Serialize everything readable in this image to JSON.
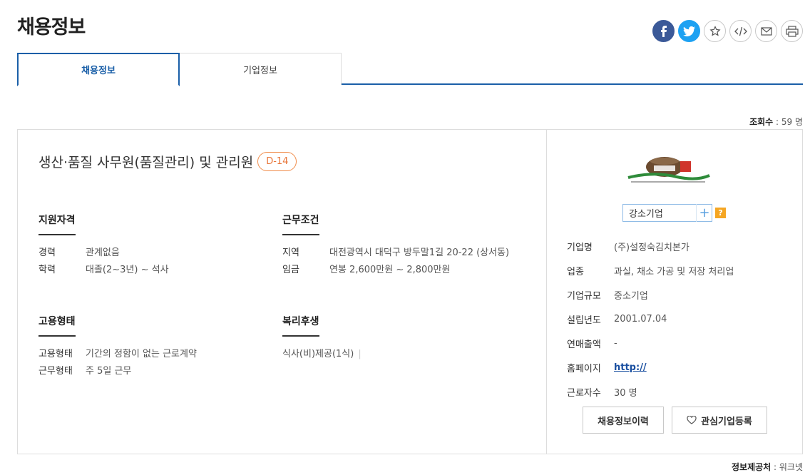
{
  "page": {
    "title": "채용정보"
  },
  "share": {
    "icons": [
      "facebook-icon",
      "twitter-icon",
      "star-icon",
      "embed-icon",
      "mail-icon",
      "print-icon"
    ]
  },
  "tabs": [
    {
      "label": "채용정보",
      "active": true
    },
    {
      "label": "기업정보",
      "active": false
    }
  ],
  "views": {
    "label": "조회수",
    "value": " : 59 명"
  },
  "job": {
    "title": "생산·품질 사무원(품질관리) 및 관리원",
    "dday": "D-14"
  },
  "sections": {
    "qualification": {
      "heading": "지원자격",
      "rows": [
        {
          "key": "경력",
          "value": "관계없음"
        },
        {
          "key": "학력",
          "value": "대졸(2~3년) ~ 석사"
        }
      ]
    },
    "conditions": {
      "heading": "근무조건",
      "rows": [
        {
          "key": "지역",
          "value": "대전광역시 대덕구 방두말1길 20-22 (상서동)"
        },
        {
          "key": "임금",
          "value": "연봉 2,600만원 ~ 2,800만원"
        }
      ]
    },
    "employment": {
      "heading": "고용형태",
      "rows": [
        {
          "key": "고용형태",
          "value": "기간의 정함이 없는 근로계약"
        },
        {
          "key": "근무형태",
          "value": "주 5일 근무"
        }
      ]
    },
    "welfare": {
      "heading": "복리후생",
      "items": "식사(비)제공(1식)"
    }
  },
  "company": {
    "size_badge": "강소기업",
    "size_plus": "+",
    "help": "?",
    "info": [
      {
        "key": "기업명",
        "value": "(주)설정숙김치본가"
      },
      {
        "key": "업종",
        "value": "과실, 채소 가공 및 저장 처리업"
      },
      {
        "key": "기업규모",
        "value": "중소기업"
      },
      {
        "key": "설립년도",
        "value": "2001.07.04"
      },
      {
        "key": "연매출액",
        "value": "-"
      },
      {
        "key": "홈페이지",
        "value": "http://"
      },
      {
        "key": "근로자수",
        "value": "30 명"
      }
    ],
    "buttons": {
      "history": "채용정보이력",
      "favorite": "관심기업등록"
    }
  },
  "provider": {
    "label": "정보제공처",
    "value": " : 워크넷"
  },
  "colors": {
    "accent": "#1a5fa8",
    "dday": "#e8763a",
    "facebook": "#3b5998",
    "twitter": "#1da1f2"
  }
}
